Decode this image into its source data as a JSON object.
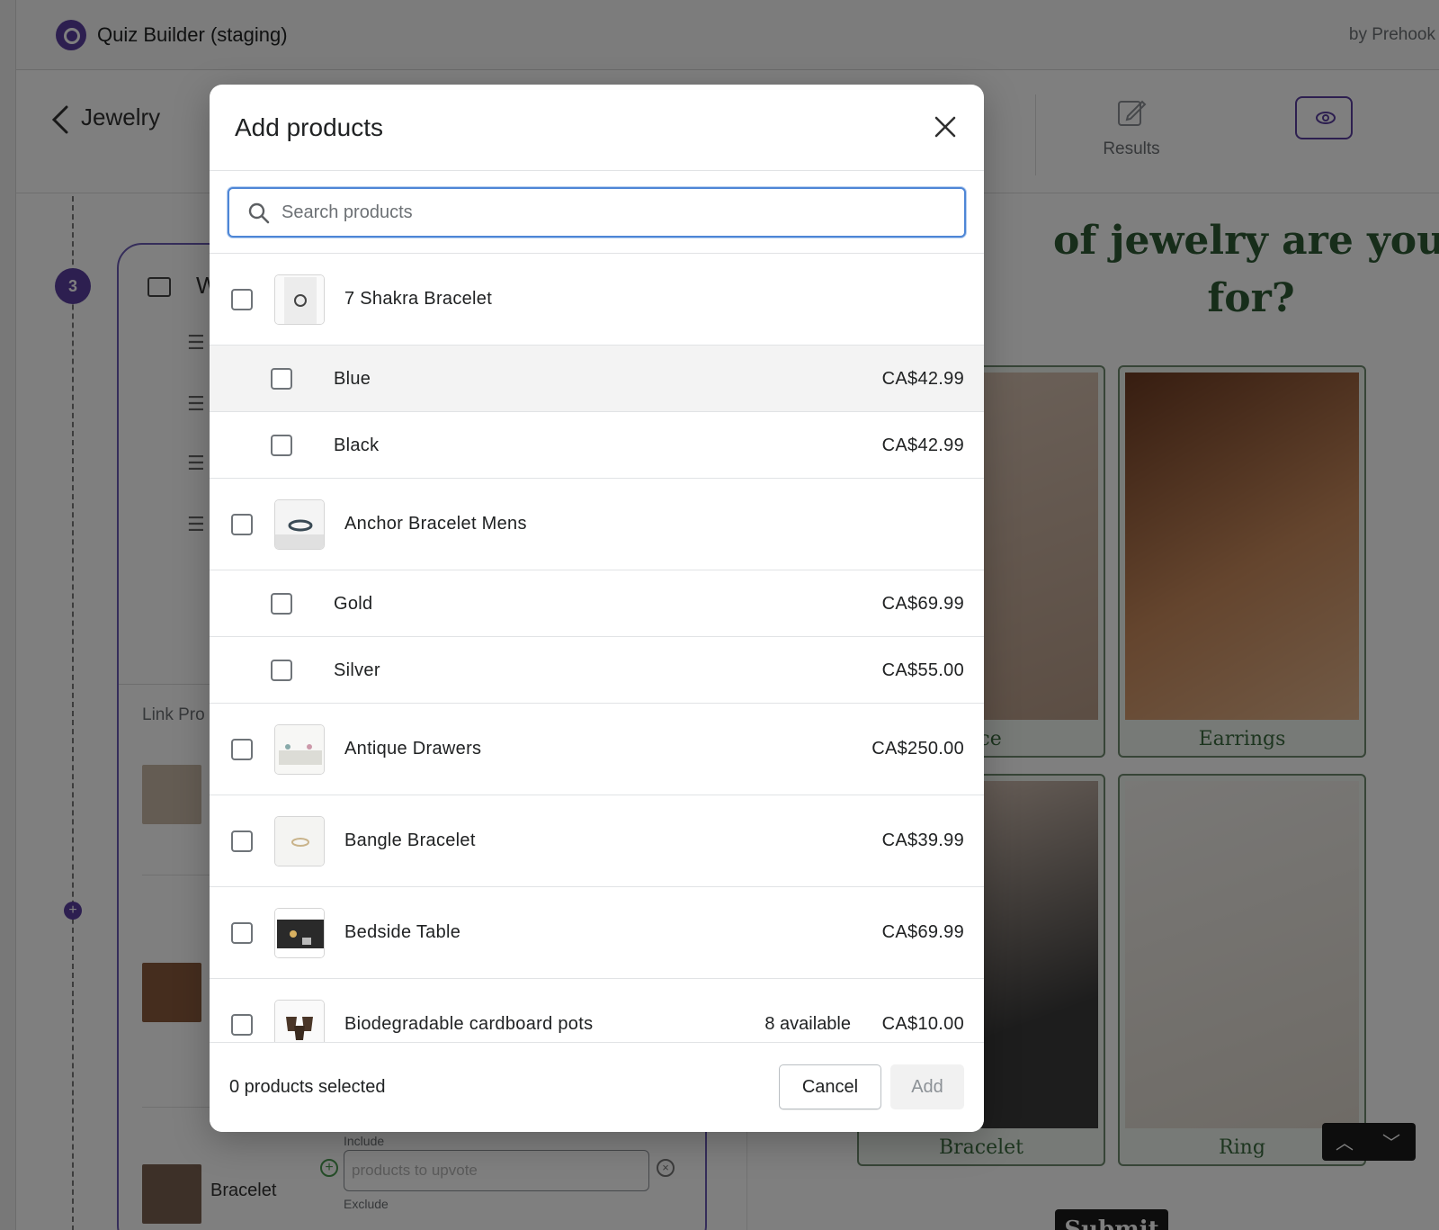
{
  "app": {
    "title": "Quiz Builder (staging)",
    "by": "by Prehook"
  },
  "subheader": {
    "page_name": "Jewelry",
    "results_tab": "Results"
  },
  "editor": {
    "step_number": "3",
    "card_title": "W",
    "link_label": "Link Pro",
    "option_label": "Bracelet",
    "include_label": "Include",
    "include_placeholder": "products to upvote",
    "exclude_label": "Exclude"
  },
  "preview": {
    "question_line1": "of jewelry are you looking",
    "question_line2": "for?",
    "answers": [
      "lace",
      "Earrings",
      "Bracelet",
      "Ring"
    ],
    "submit": "Submit"
  },
  "modal": {
    "title": "Add products",
    "search_placeholder": "Search products",
    "rows": [
      {
        "kind": "product",
        "name": "7 Shakra Bracelet",
        "price": "",
        "available": "",
        "thumb": "bracelet-thumb"
      },
      {
        "kind": "variant",
        "name": "Blue",
        "price": "CA$42.99",
        "highlighted": true
      },
      {
        "kind": "variant",
        "name": "Black",
        "price": "CA$42.99"
      },
      {
        "kind": "product",
        "name": "Anchor Bracelet Mens",
        "price": "",
        "available": "",
        "thumb": "anchor-bracelet-thumb"
      },
      {
        "kind": "variant",
        "name": "Gold",
        "price": "CA$69.99"
      },
      {
        "kind": "variant",
        "name": "Silver",
        "price": "CA$55.00"
      },
      {
        "kind": "product",
        "name": "Antique Drawers",
        "price": "CA$250.00",
        "available": "",
        "thumb": "drawers-thumb"
      },
      {
        "kind": "product",
        "name": "Bangle Bracelet",
        "price": "CA$39.99",
        "available": "",
        "thumb": "bangle-thumb"
      },
      {
        "kind": "product",
        "name": "Bedside Table",
        "price": "CA$69.99",
        "available": "",
        "thumb": "table-thumb"
      },
      {
        "kind": "product",
        "name": "Biodegradable cardboard pots",
        "price": "CA$10.00",
        "available": "8 available",
        "thumb": "pots-thumb"
      }
    ],
    "selected_count": "0 products selected",
    "cancel_label": "Cancel",
    "add_label": "Add"
  },
  "colors": {
    "brand": "#5a3fa0",
    "focus": "#4e86d6",
    "quiz_green": "#2e5a34"
  }
}
